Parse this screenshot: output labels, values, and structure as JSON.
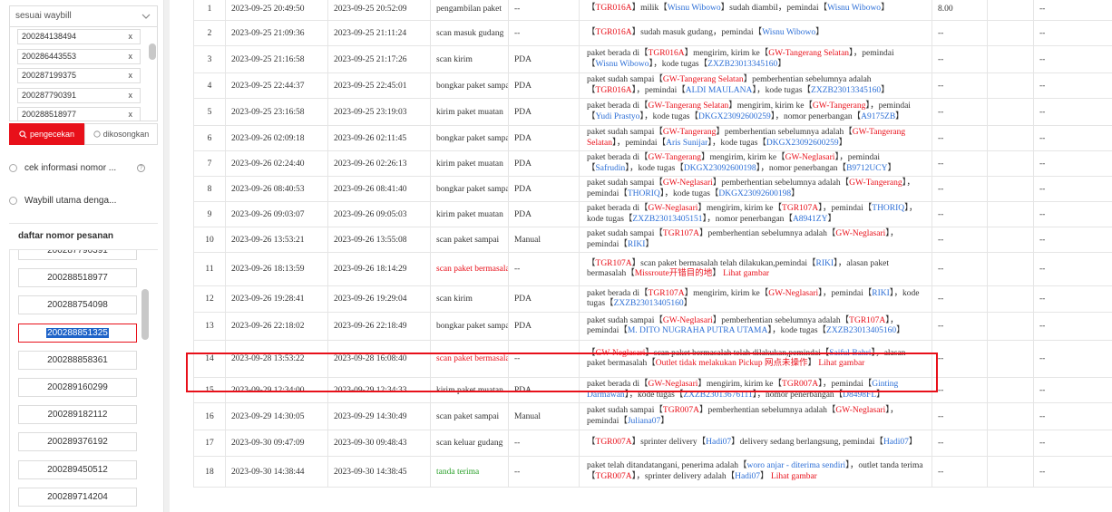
{
  "filter": {
    "dropdown_label": "sesuai waybill",
    "waybills": [
      "200284138494",
      "200286443553",
      "200287199375",
      "200287790391",
      "200288518977"
    ],
    "tag_close": "x",
    "search_button": "pengecekan",
    "clear_button": "dikosongkan",
    "option_1": "cek informasi nomor ...",
    "option_2": "Waybill utama denga...",
    "help_glyph": "?"
  },
  "order_list": {
    "title": "daftar nomor pesanan",
    "items": [
      "200287790391",
      "200288518977",
      "200288754098",
      "200288851325",
      "200288858361",
      "200289160299",
      "200289182112",
      "200289376192",
      "200289450512",
      "200289714204"
    ],
    "selected_index": 3
  },
  "colors": {
    "accent_red": "#e8101a",
    "link_blue": "#2d6fd6",
    "success_green": "#2aa02a"
  },
  "tracking": {
    "rows": [
      {
        "no": "1",
        "time1": "2023-09-25 20:49:50",
        "time2": "2023-09-25 20:52:09",
        "event": "pengambilan paket",
        "device": "--",
        "info": [
          {
            "t": "【",
            "c": ""
          },
          {
            "t": "TGR016A",
            "c": "r"
          },
          {
            "t": "】milik【",
            "c": ""
          },
          {
            "t": "Wisnu Wibowo",
            "c": "b"
          },
          {
            "t": "】sudah diambil，pemindai【",
            "c": ""
          },
          {
            "t": "Wisnu Wibowo",
            "c": "b"
          },
          {
            "t": "】",
            "c": ""
          }
        ],
        "weight": "8.00",
        "c9": "--"
      },
      {
        "no": "2",
        "time1": "2023-09-25 21:09:36",
        "time2": "2023-09-25 21:11:24",
        "event": "scan masuk gudang",
        "device": "--",
        "info": [
          {
            "t": "【",
            "c": ""
          },
          {
            "t": "TGR016A",
            "c": "r"
          },
          {
            "t": "】sudah masuk gudang，pemindai【",
            "c": ""
          },
          {
            "t": "Wisnu Wibowo",
            "c": "b"
          },
          {
            "t": "】",
            "c": ""
          }
        ],
        "weight": "--",
        "c9": "--"
      },
      {
        "no": "3",
        "time1": "2023-09-25 21:16:58",
        "time2": "2023-09-25 21:17:26",
        "event": "scan kirim",
        "device": "PDA",
        "info": [
          {
            "t": "paket berada di【",
            "c": ""
          },
          {
            "t": "TGR016A",
            "c": "r"
          },
          {
            "t": "】mengirim, kirim ke【",
            "c": ""
          },
          {
            "t": "GW-Tangerang Selatan",
            "c": "r"
          },
          {
            "t": "】，pemindai【",
            "c": ""
          },
          {
            "t": "Wisnu Wibowo",
            "c": "b"
          },
          {
            "t": "】，kode tugas【",
            "c": ""
          },
          {
            "t": "ZXZB23013345160",
            "c": "b"
          },
          {
            "t": "】",
            "c": ""
          }
        ],
        "weight": "--",
        "c9": "--"
      },
      {
        "no": "4",
        "time1": "2023-09-25 22:44:37",
        "time2": "2023-09-25 22:45:01",
        "event": "bongkar paket sampai",
        "device": "PDA",
        "info": [
          {
            "t": "paket sudah sampai【",
            "c": ""
          },
          {
            "t": "GW-Tangerang Selatan",
            "c": "r"
          },
          {
            "t": "】pemberhentian sebelumnya adalah【",
            "c": ""
          },
          {
            "t": "TGR016A",
            "c": "r"
          },
          {
            "t": "】，pemindai【",
            "c": ""
          },
          {
            "t": "ALDI MAULANA",
            "c": "b"
          },
          {
            "t": "】，kode tugas【",
            "c": ""
          },
          {
            "t": "ZXZB23013345160",
            "c": "b"
          },
          {
            "t": "】",
            "c": ""
          }
        ],
        "weight": "--",
        "c9": "--"
      },
      {
        "no": "5",
        "time1": "2023-09-25 23:16:58",
        "time2": "2023-09-25 23:19:03",
        "event": "kirim paket muatan",
        "device": "PDA",
        "info": [
          {
            "t": "paket berada di【",
            "c": ""
          },
          {
            "t": "GW-Tangerang Selatan",
            "c": "r"
          },
          {
            "t": "】mengirim, kirim ke【",
            "c": ""
          },
          {
            "t": "GW-Tangerang",
            "c": "r"
          },
          {
            "t": "】，pemindai【",
            "c": ""
          },
          {
            "t": "Yudi Prastyo",
            "c": "b"
          },
          {
            "t": "】，kode tugas【",
            "c": ""
          },
          {
            "t": "DKGX23092600259",
            "c": "b"
          },
          {
            "t": "】，nomor penerbangan【",
            "c": ""
          },
          {
            "t": "A9175ZB",
            "c": "b"
          },
          {
            "t": "】",
            "c": ""
          }
        ],
        "weight": "--",
        "c9": "--"
      },
      {
        "no": "6",
        "time1": "2023-09-26 02:09:18",
        "time2": "2023-09-26 02:11:45",
        "event": "bongkar paket sampai",
        "device": "PDA",
        "info": [
          {
            "t": "paket sudah sampai【",
            "c": ""
          },
          {
            "t": "GW-Tangerang",
            "c": "r"
          },
          {
            "t": "】pemberhentian sebelumnya adalah【",
            "c": ""
          },
          {
            "t": "GW-Tangerang Selatan",
            "c": "r"
          },
          {
            "t": "】，pemindai【",
            "c": ""
          },
          {
            "t": "Aris Sunijar",
            "c": "b"
          },
          {
            "t": "】，kode tugas【",
            "c": ""
          },
          {
            "t": "DKGX23092600259",
            "c": "b"
          },
          {
            "t": "】",
            "c": ""
          }
        ],
        "weight": "--",
        "c9": "--"
      },
      {
        "no": "7",
        "time1": "2023-09-26 02:24:40",
        "time2": "2023-09-26 02:26:13",
        "event": "kirim paket muatan",
        "device": "PDA",
        "info": [
          {
            "t": "paket berada di【",
            "c": ""
          },
          {
            "t": "GW-Tangerang",
            "c": "r"
          },
          {
            "t": "】mengirim, kirim ke【",
            "c": ""
          },
          {
            "t": "GW-Neglasari",
            "c": "r"
          },
          {
            "t": "】，pemindai【",
            "c": ""
          },
          {
            "t": "Safrudin",
            "c": "b"
          },
          {
            "t": "】，kode tugas【",
            "c": ""
          },
          {
            "t": "DKGX23092600198",
            "c": "b"
          },
          {
            "t": "】，nomor penerbangan【",
            "c": ""
          },
          {
            "t": "B9712UCY",
            "c": "b"
          },
          {
            "t": "】",
            "c": ""
          }
        ],
        "weight": "--",
        "c9": "--"
      },
      {
        "no": "8",
        "time1": "2023-09-26 08:40:53",
        "time2": "2023-09-26 08:41:40",
        "event": "bongkar paket sampai",
        "device": "PDA",
        "info": [
          {
            "t": "paket sudah sampai【",
            "c": ""
          },
          {
            "t": "GW-Neglasari",
            "c": "r"
          },
          {
            "t": "】pemberhentian sebelumnya adalah【",
            "c": ""
          },
          {
            "t": "GW-Tangerang",
            "c": "r"
          },
          {
            "t": "】，pemindai【",
            "c": ""
          },
          {
            "t": "THORIQ",
            "c": "b"
          },
          {
            "t": "】，kode tugas【",
            "c": ""
          },
          {
            "t": "DKGX23092600198",
            "c": "b"
          },
          {
            "t": "】",
            "c": ""
          }
        ],
        "weight": "--",
        "c9": "--"
      },
      {
        "no": "9",
        "time1": "2023-09-26 09:03:07",
        "time2": "2023-09-26 09:05:03",
        "event": "kirim paket muatan",
        "device": "PDA",
        "info": [
          {
            "t": "paket berada di【",
            "c": ""
          },
          {
            "t": "GW-Neglasari",
            "c": "r"
          },
          {
            "t": "】mengirim, kirim ke【",
            "c": ""
          },
          {
            "t": "TGR107A",
            "c": "r"
          },
          {
            "t": "】，pemindai【",
            "c": ""
          },
          {
            "t": "THORIQ",
            "c": "b"
          },
          {
            "t": "】，kode tugas【",
            "c": ""
          },
          {
            "t": "ZXZB23013405151",
            "c": "b"
          },
          {
            "t": "】，nomor penerbangan【",
            "c": ""
          },
          {
            "t": "A8941ZY",
            "c": "b"
          },
          {
            "t": "】",
            "c": ""
          }
        ],
        "weight": "--",
        "c9": "--"
      },
      {
        "no": "10",
        "time1": "2023-09-26 13:53:21",
        "time2": "2023-09-26 13:55:08",
        "event": "scan paket sampai",
        "device": "Manual",
        "info": [
          {
            "t": "paket sudah sampai【",
            "c": ""
          },
          {
            "t": "TGR107A",
            "c": "r"
          },
          {
            "t": "】pemberhentian sebelumnya adalah【",
            "c": ""
          },
          {
            "t": "GW-Neglasari",
            "c": "r"
          },
          {
            "t": "】，pemindai【",
            "c": ""
          },
          {
            "t": "RIKI",
            "c": "b"
          },
          {
            "t": "】",
            "c": ""
          }
        ],
        "weight": "--",
        "c9": "--"
      },
      {
        "no": "11",
        "time1": "2023-09-26 18:13:59",
        "time2": "2023-09-26 18:14:29",
        "event": "scan paket bermasalah",
        "device": "--",
        "ev_red": true,
        "info": [
          {
            "t": "【",
            "c": ""
          },
          {
            "t": "TGR107A",
            "c": "r"
          },
          {
            "t": "】scan paket bermasalah telah dilakukan,pemindai【",
            "c": ""
          },
          {
            "t": "RIKI",
            "c": "b"
          },
          {
            "t": "】，alasan paket bermasalah【",
            "c": ""
          },
          {
            "t": "Missroute开错目的地",
            "c": "r"
          },
          {
            "t": "】",
            "c": ""
          },
          {
            "t": "  Lihat gambar",
            "c": "r"
          }
        ],
        "weight": "--",
        "c9": "--"
      },
      {
        "no": "12",
        "time1": "2023-09-26 19:28:41",
        "time2": "2023-09-26 19:29:04",
        "event": "scan kirim",
        "device": "PDA",
        "info": [
          {
            "t": "paket berada di【",
            "c": ""
          },
          {
            "t": "TGR107A",
            "c": "r"
          },
          {
            "t": "】mengirim, kirim ke【",
            "c": ""
          },
          {
            "t": "GW-Neglasari",
            "c": "r"
          },
          {
            "t": "】，pemindai【",
            "c": ""
          },
          {
            "t": "RIKI",
            "c": "b"
          },
          {
            "t": "】，kode tugas【",
            "c": ""
          },
          {
            "t": "ZXZB23013405160",
            "c": "b"
          },
          {
            "t": "】",
            "c": ""
          }
        ],
        "weight": "--",
        "c9": "--"
      },
      {
        "no": "13",
        "time1": "2023-09-26 22:18:02",
        "time2": "2023-09-26 22:18:49",
        "event": "bongkar paket sampai",
        "device": "PDA",
        "info": [
          {
            "t": "paket sudah sampai【",
            "c": ""
          },
          {
            "t": "GW-Neglasari",
            "c": "r"
          },
          {
            "t": "】pemberhentian sebelumnya adalah【",
            "c": ""
          },
          {
            "t": "TGR107A",
            "c": "r"
          },
          {
            "t": "】，pemindai【",
            "c": ""
          },
          {
            "t": "M. DITO NUGRAHA PUTRA UTAMA",
            "c": "b"
          },
          {
            "t": "】，kode tugas【",
            "c": ""
          },
          {
            "t": "ZXZB23013405160",
            "c": "b"
          },
          {
            "t": "】",
            "c": ""
          }
        ],
        "weight": "--",
        "c9": "--"
      },
      {
        "no": "14",
        "time1": "2023-09-28 13:53:22",
        "time2": "2023-09-28 16:08:40",
        "event": "scan paket bermasalah",
        "device": "--",
        "ev_red": true,
        "info": [
          {
            "t": "【",
            "c": ""
          },
          {
            "t": "GW-Neglasari",
            "c": "r"
          },
          {
            "t": "】scan paket bermasalah telah dilakukan,pemindai【",
            "c": ""
          },
          {
            "t": "Saiful Bahri",
            "c": "b"
          },
          {
            "t": "】，alasan paket bermasalah【",
            "c": ""
          },
          {
            "t": "Outlet tidak melakukan Pickup 网点未操作",
            "c": "r"
          },
          {
            "t": "】",
            "c": ""
          },
          {
            "t": "  Lihat gambar",
            "c": "r"
          }
        ],
        "weight": "--",
        "c9": "--"
      },
      {
        "no": "15",
        "time1": "2023-09-29 12:34:00",
        "time2": "2023-09-29 12:34:33",
        "event": "kirim paket muatan",
        "device": "PDA",
        "info": [
          {
            "t": "paket berada di【",
            "c": ""
          },
          {
            "t": "GW-Neglasari",
            "c": "r"
          },
          {
            "t": "】mengirim, kirim ke【",
            "c": ""
          },
          {
            "t": "TGR007A",
            "c": "r"
          },
          {
            "t": "】，pemindai【",
            "c": ""
          },
          {
            "t": "Ginting Darmawan",
            "c": "b"
          },
          {
            "t": "】，kode tugas【",
            "c": ""
          },
          {
            "t": "ZXZB23013676111",
            "c": "b"
          },
          {
            "t": "】，nomor penerbangan【",
            "c": ""
          },
          {
            "t": "D8498FL",
            "c": "b"
          },
          {
            "t": "】",
            "c": ""
          }
        ],
        "weight": "--",
        "c9": "--"
      },
      {
        "no": "16",
        "time1": "2023-09-29 14:30:05",
        "time2": "2023-09-29 14:30:49",
        "event": "scan paket sampai",
        "device": "Manual",
        "info": [
          {
            "t": "paket sudah sampai【",
            "c": ""
          },
          {
            "t": "TGR007A",
            "c": "r"
          },
          {
            "t": "】pemberhentian sebelumnya adalah【",
            "c": ""
          },
          {
            "t": "GW-Neglasari",
            "c": "r"
          },
          {
            "t": "】，pemindai【",
            "c": ""
          },
          {
            "t": "Juliana07",
            "c": "b"
          },
          {
            "t": "】",
            "c": ""
          }
        ],
        "weight": "--",
        "c9": "--"
      },
      {
        "no": "17",
        "time1": "2023-09-30 09:47:09",
        "time2": "2023-09-30 09:48:43",
        "event": "scan keluar gudang",
        "device": "--",
        "info": [
          {
            "t": "【",
            "c": ""
          },
          {
            "t": "TGR007A",
            "c": "r"
          },
          {
            "t": "】sprinter delivery【",
            "c": ""
          },
          {
            "t": "Hadi07",
            "c": "b"
          },
          {
            "t": "】delivery sedang berlangsung, pemindai【",
            "c": ""
          },
          {
            "t": "Hadi07",
            "c": "b"
          },
          {
            "t": "】",
            "c": ""
          }
        ],
        "weight": "--",
        "c9": "--"
      },
      {
        "no": "18",
        "time1": "2023-09-30 14:38:44",
        "time2": "2023-09-30 14:38:45",
        "event": "tanda terima",
        "device": "--",
        "ev_green": true,
        "info": [
          {
            "t": "paket telah ditandatangani, penerima adalah【",
            "c": ""
          },
          {
            "t": "woro anjar - diterima sendiri",
            "c": "b"
          },
          {
            "t": "】，outlet tanda terima【",
            "c": ""
          },
          {
            "t": "TGR007A",
            "c": "r"
          },
          {
            "t": "】，sprinter delivery adalah【",
            "c": ""
          },
          {
            "t": "Hadi07",
            "c": "b"
          },
          {
            "t": "】",
            "c": ""
          },
          {
            "t": "  Lihat gambar",
            "c": "r"
          }
        ],
        "weight": "--",
        "c9": "--"
      }
    ]
  }
}
